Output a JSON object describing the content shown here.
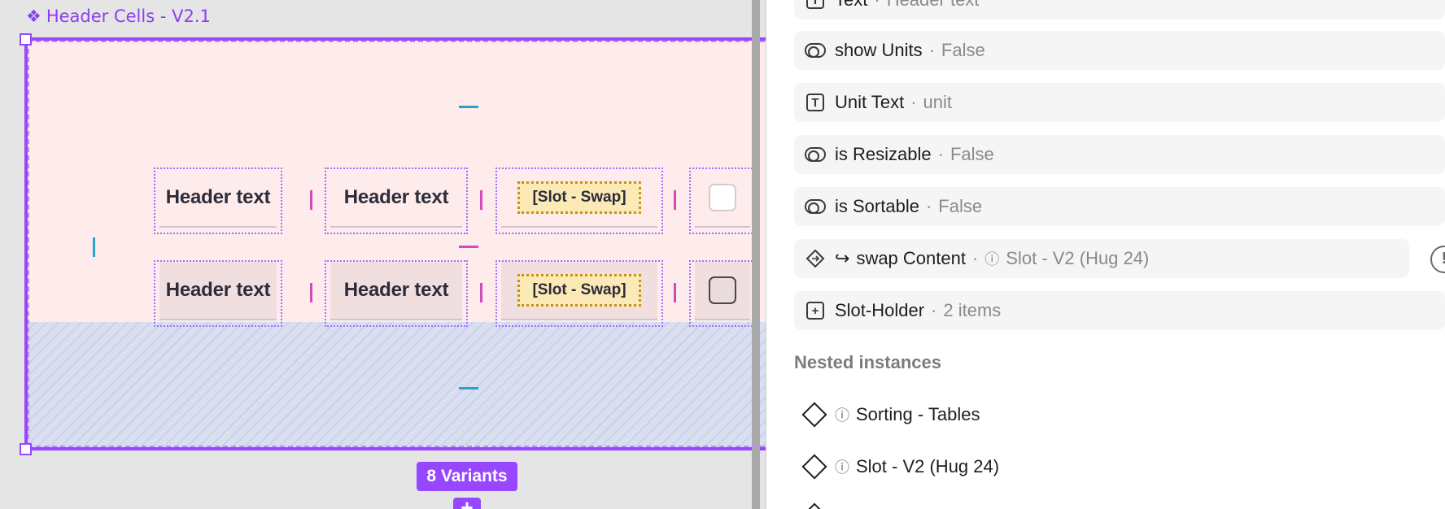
{
  "canvas": {
    "component_set_title": "Header Cells - V2.1",
    "title_glyph": "❖",
    "rows": [
      {
        "cells": [
          {
            "kind": "text",
            "label": "Header text"
          },
          {
            "kind": "text",
            "label": "Header text"
          },
          {
            "kind": "slot",
            "label": "[Slot - Swap]"
          },
          {
            "kind": "checkbox",
            "label": ""
          }
        ]
      },
      {
        "cells": [
          {
            "kind": "text",
            "label": "Header text"
          },
          {
            "kind": "text",
            "label": "Header text"
          },
          {
            "kind": "slot",
            "label": "[Slot - Swap]"
          },
          {
            "kind": "checkbox",
            "label": ""
          }
        ]
      }
    ],
    "variants_badge": "8 Variants",
    "add_variant_glyph": "+"
  },
  "properties": {
    "items": [
      {
        "icon": "text-icon",
        "name": "Text",
        "value": "Header text"
      },
      {
        "icon": "toggle-icon",
        "name": "show Units",
        "value": "False"
      },
      {
        "icon": "text-icon",
        "name": "Unit Text",
        "value": "unit"
      },
      {
        "icon": "toggle-icon",
        "name": "is Resizable",
        "value": "False"
      },
      {
        "icon": "toggle-icon",
        "name": "is Sortable",
        "value": "False"
      },
      {
        "icon": "instance-swap-icon",
        "name": "swap Content",
        "value": "Slot - V2 (Hug 24)"
      },
      {
        "icon": "slot-icon",
        "name": "Slot-Holder",
        "value": "2 items"
      }
    ],
    "separator": "·",
    "info_glyph": "ⓘ",
    "swap_glyph": "↪",
    "warning_glyph": "!"
  },
  "nested_instances": {
    "heading": "Nested instances",
    "items": [
      {
        "label": "Sorting - Tables"
      },
      {
        "label": "Slot - V2 (Hug 24)"
      }
    ]
  },
  "colors": {
    "component_purple": "#9747ff",
    "canvas_bg": "#e5e5e5",
    "frame_fill": "#fdeceb",
    "slot_fill": "#fbe9b6",
    "resize_handle_pink": "#d24bb8"
  }
}
